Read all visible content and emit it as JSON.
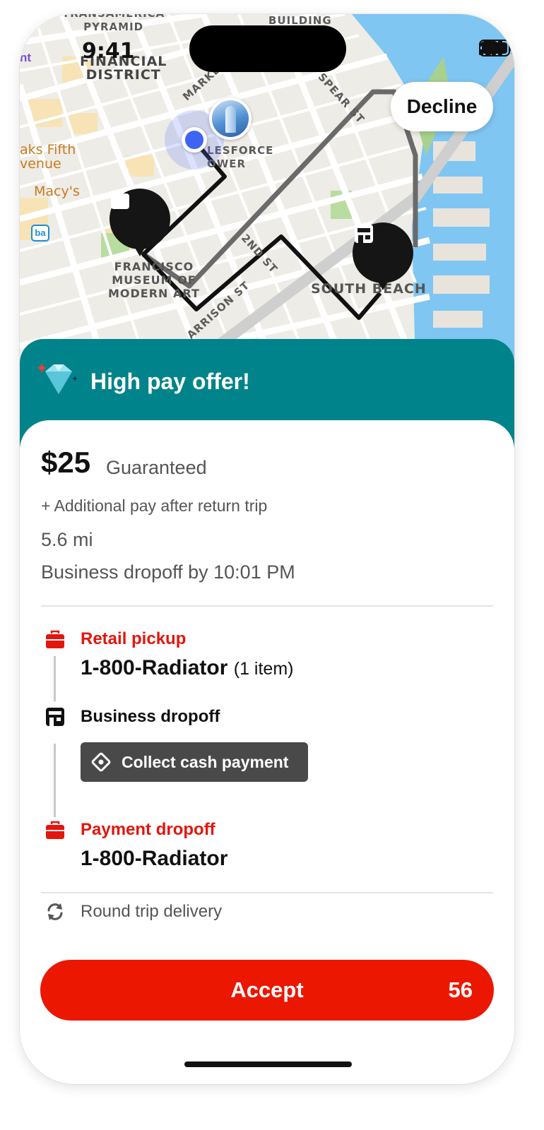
{
  "status_bar": {
    "time": "9:41"
  },
  "map": {
    "labels": {
      "transamerica": "TRANSAMERICA\nPYRAMID",
      "financial": "FINANCIAL\nDISTRICT",
      "building": "BUILDING",
      "saks": "aks Fifth\nvenue",
      "macys": "Macy's",
      "salesforce": "LESFORCE\nOWER",
      "museum": "FRANCISCO\nMUSEUM OF\nMODERN ART",
      "south_beach": "SOUTH BEACH",
      "spear": "SPEAR ST",
      "second": "2ND ST",
      "harrison": "ARRISON ST",
      "market": "MARKET ST",
      "bart": "ba",
      "nt": "nt"
    },
    "decline_label": "Decline",
    "pins": [
      "pickup-bag-icon",
      "dropoff-store-icon"
    ]
  },
  "offer": {
    "title": "High pay offer!"
  },
  "pay": {
    "amount": "$25",
    "guaranteed_label": "Guaranteed",
    "additional": "+ Additional pay after return trip",
    "distance": "5.6 mi",
    "deadline": "Business dropoff by 10:01 PM"
  },
  "stops": [
    {
      "label": "Retail pickup",
      "name": "1-800-Radiator",
      "extra": "(1 item)",
      "icon": "red-bag-icon"
    },
    {
      "label": "Business dropoff",
      "badge": "Collect cash payment",
      "icon": "store-icon"
    },
    {
      "label": "Payment dropoff",
      "name": "1-800-Radiator",
      "icon": "red-bag-icon"
    }
  ],
  "round_trip": "Round trip delivery",
  "accept": {
    "label": "Accept",
    "count": "56"
  },
  "colors": {
    "brand_red": "#eb1700",
    "teal": "#00838a",
    "label_red": "#e3150c",
    "cash_pill": "#494949"
  }
}
